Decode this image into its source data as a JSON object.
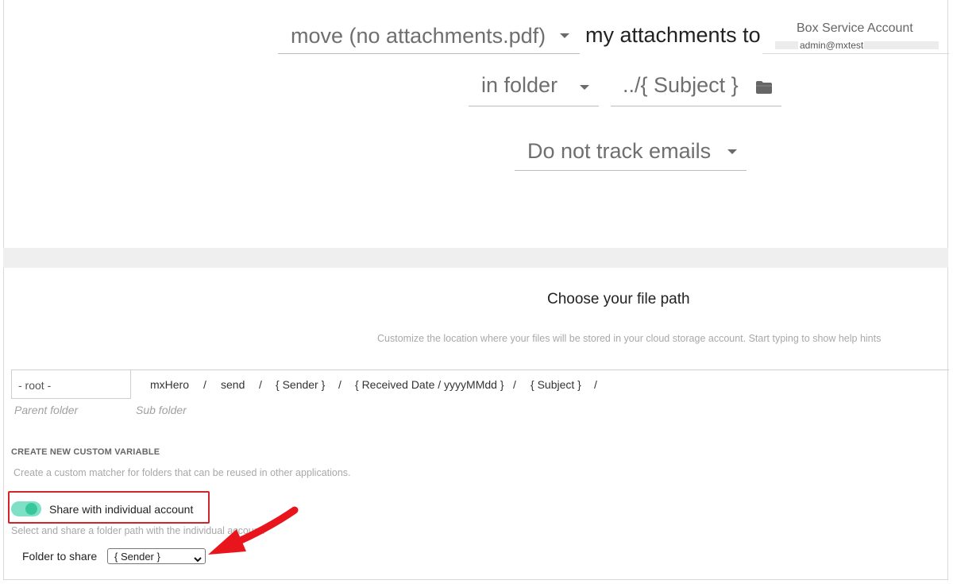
{
  "rule": {
    "action_select": "move (no attachments.pdf)",
    "connector_text": "my attachments to",
    "account": {
      "name": "Box Service Account",
      "email_prefix": "admin@mxtest-"
    },
    "folder_mode_select": "in folder",
    "folder_path_value": "../{ Subject }",
    "tracking_select": "Do not track emails"
  },
  "file_path": {
    "heading": "Choose your file path",
    "hint": "Customize the location where your files will be stored in your cloud storage account. Start typing to show help hints",
    "parent_value": "- root -",
    "parent_label": "Parent folder",
    "sub_label": "Sub folder",
    "segments": [
      "mxHero",
      "send",
      "{ Sender }",
      "{ Received Date / yyyyMMdd }",
      "{ Subject }"
    ],
    "separator": "/"
  },
  "custom_variable": {
    "title": "CREATE NEW CUSTOM VARIABLE",
    "description": "Create a custom matcher for folders that can be reused in other applications."
  },
  "share": {
    "toggle_label": "Share with individual account",
    "toggle_on": true,
    "description": "Select and share a folder path with the individual account.",
    "folder_label": "Folder to share",
    "folder_select": "{ Sender }"
  },
  "colors": {
    "toggle_on": "#38c79a",
    "highlight": "#d0262b",
    "arrow": "#e8161c"
  },
  "icons": [
    "caret-down-icon",
    "folder-icon",
    "chevron-down-icon",
    "arrow-pointer-icon"
  ]
}
